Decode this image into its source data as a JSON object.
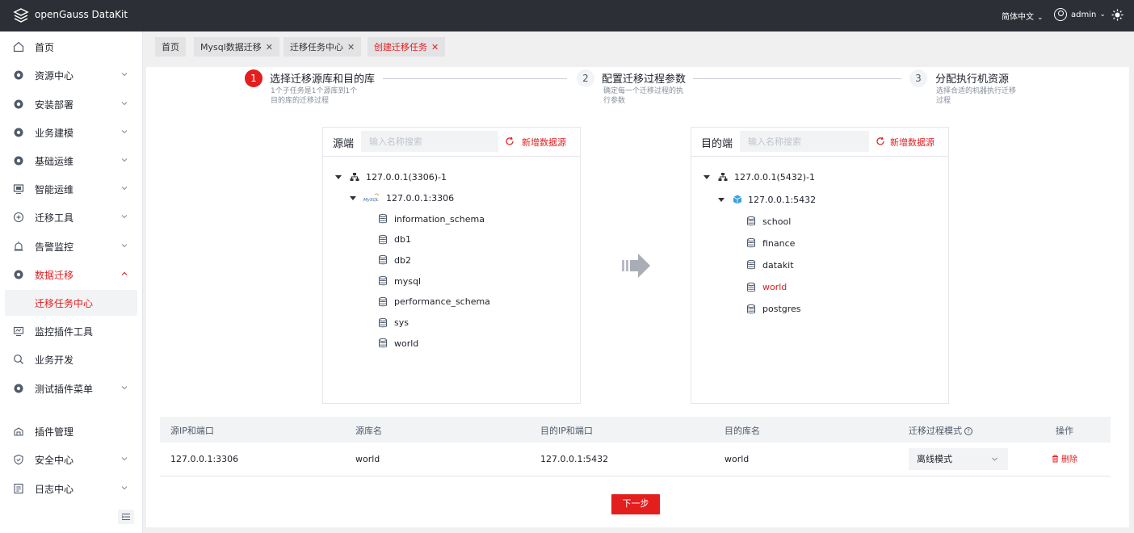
{
  "app": {
    "title": "openGauss DataKit",
    "language": "简体中文",
    "user": "admin"
  },
  "colors": {
    "accent": "#e41d1d",
    "topbar": "#2c2f36"
  },
  "sidebar": {
    "items": [
      {
        "label": "首页",
        "icon": "home-icon"
      },
      {
        "label": "资源中心",
        "icon": "gear-icon"
      },
      {
        "label": "安装部署",
        "icon": "gear-icon"
      },
      {
        "label": "业务建模",
        "icon": "gear-icon"
      },
      {
        "label": "基础运维",
        "icon": "gear-icon"
      },
      {
        "label": "智能运维",
        "icon": "monitor-icon"
      },
      {
        "label": "迁移工具",
        "icon": "plus-circle-icon"
      },
      {
        "label": "告警监控",
        "icon": "alarm-icon"
      },
      {
        "label": "数据迁移",
        "icon": "gear-icon"
      },
      {
        "label": "迁移任务中心",
        "icon": ""
      },
      {
        "label": "监控插件工具",
        "icon": "monitor-tool-icon"
      },
      {
        "label": "业务开发",
        "icon": "search-icon"
      },
      {
        "label": "测试插件菜单",
        "icon": "gear-icon"
      },
      {
        "label": "插件管理",
        "icon": "plugin-icon"
      },
      {
        "label": "安全中心",
        "icon": "shield-icon"
      },
      {
        "label": "日志中心",
        "icon": "log-icon"
      }
    ]
  },
  "tabs": [
    {
      "label": "首页"
    },
    {
      "label": "Mysql数据迁移"
    },
    {
      "label": "迁移任务中心"
    },
    {
      "label": "创建迁移任务"
    }
  ],
  "steps": [
    {
      "num": "1",
      "title": "选择迁移源库和目的库",
      "desc1": "1个子任务是1个源库到1个",
      "desc2": "目的库的迁移过程"
    },
    {
      "num": "2",
      "title": "配置迁移过程参数",
      "desc1": "确定每一个迁移过程的执",
      "desc2": "行参数"
    },
    {
      "num": "3",
      "title": "分配执行机资源",
      "desc1": "选择合适的机器执行迁移",
      "desc2": "过程"
    }
  ],
  "source": {
    "title": "源端",
    "search_placeholder": "输入名称搜索",
    "add_label": "新增数据源",
    "cluster": "127.0.0.1(3306)-1",
    "instance": "127.0.0.1:3306",
    "instance_badge": "MySQL",
    "databases": [
      "information_schema",
      "db1",
      "db2",
      "mysql",
      "performance_schema",
      "sys",
      "world"
    ]
  },
  "target": {
    "title": "目的端",
    "search_placeholder": "输入名称搜索",
    "add_label": "新增数据源",
    "cluster": "127.0.0.1(5432)-1",
    "instance": "127.0.0.1:5432",
    "databases": [
      "school",
      "finance",
      "datakit",
      "world",
      "postgres"
    ],
    "selected": "world"
  },
  "table": {
    "headers": [
      "源IP和端口",
      "源库名",
      "目的IP和端口",
      "目的库名",
      "迁移过程模式",
      "操作"
    ],
    "rows": [
      {
        "src_ip": "127.0.0.1:3306",
        "src_db": "world",
        "dst_ip": "127.0.0.1:5432",
        "dst_db": "world",
        "mode": "离线模式",
        "action": "删除"
      }
    ]
  },
  "next_label": "下一步"
}
